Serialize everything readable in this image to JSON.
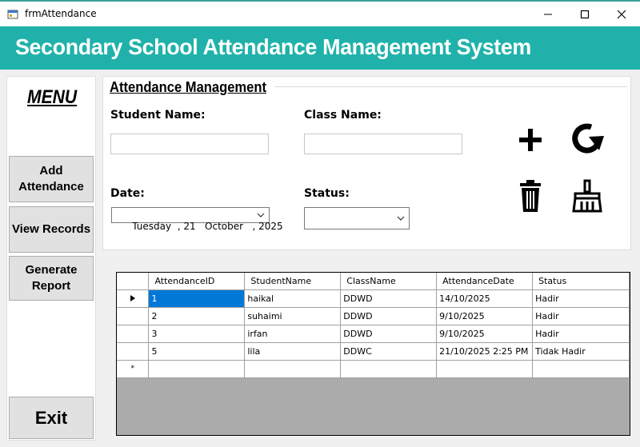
{
  "window": {
    "title": "frmAttendance"
  },
  "header": {
    "title": "Secondary School Attendance Management System"
  },
  "sidebar": {
    "menu_title": "MENU",
    "add_label": "Add\nAttendance",
    "view_label": "View Records",
    "report_label": "Generate\nReport",
    "exit_label": "Exit"
  },
  "form": {
    "title": "Attendance Management",
    "student_label": "Student Name:",
    "student_value": "",
    "class_label": "Class Name:",
    "class_value": "",
    "date_label": "Date:",
    "date_value": "Tuesday  , 21   October   , 2025",
    "status_label": "Status:",
    "status_value": ""
  },
  "actions": [
    "plus-icon",
    "refresh-icon",
    "trash-icon",
    "broom-icon"
  ],
  "grid": {
    "columns": [
      "AttendanceID",
      "StudentName",
      "ClassName",
      "AttendanceDate",
      "Status"
    ],
    "rows": [
      [
        "1",
        "haikal",
        "DDWD",
        "14/10/2025",
        "Hadir"
      ],
      [
        "2",
        "suhaimi",
        "DDWD",
        "9/10/2025",
        "Hadir"
      ],
      [
        "3",
        "irfan",
        "DDWD",
        "9/10/2025",
        "Hadir"
      ],
      [
        "5",
        "lila",
        "DDWC",
        "21/10/2025 2:25 PM",
        "Tidak Hadir"
      ]
    ],
    "new_row_marker": "*"
  },
  "colors": {
    "header": "#20b2aa",
    "selection": "#0078d7",
    "grid_bg": "#ababab"
  }
}
